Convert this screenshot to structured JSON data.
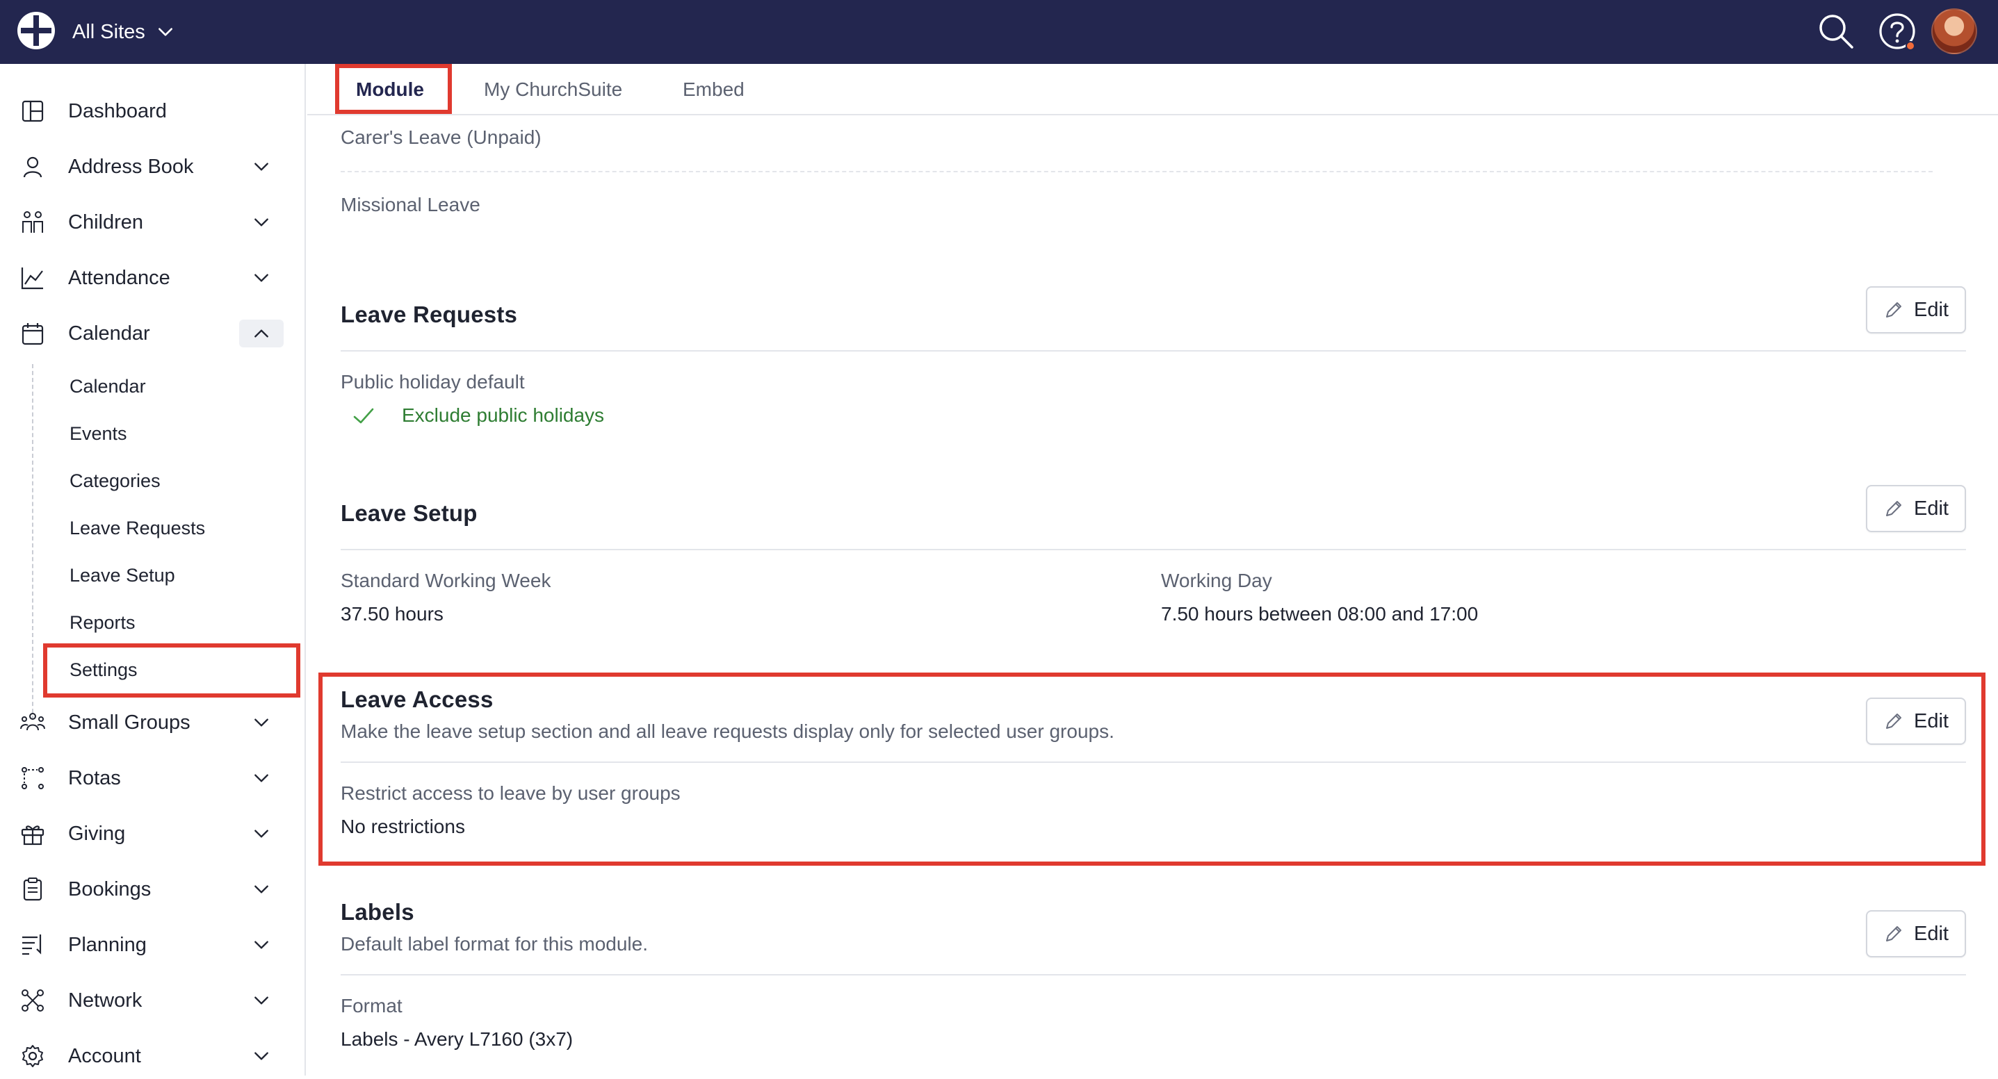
{
  "header": {
    "site_switch": "All Sites",
    "icons": [
      "churchsuite-logo-icon",
      "search-icon",
      "help-icon",
      "user-avatar"
    ],
    "colors": {
      "topbar": "#23264f",
      "highlight": "#e03a2f",
      "success": "#2e7d32"
    }
  },
  "sidebar": {
    "items": [
      {
        "label": "Dashboard",
        "icon": "dashboard-icon"
      },
      {
        "label": "Address Book",
        "icon": "person-icon"
      },
      {
        "label": "Children",
        "icon": "children-icon"
      },
      {
        "label": "Attendance",
        "icon": "chart-icon"
      },
      {
        "label": "Calendar",
        "icon": "calendar-icon"
      },
      {
        "label": "Small Groups",
        "icon": "groups-icon"
      },
      {
        "label": "Rotas",
        "icon": "rotas-icon"
      },
      {
        "label": "Giving",
        "icon": "gift-icon"
      },
      {
        "label": "Bookings",
        "icon": "clipboard-icon"
      },
      {
        "label": "Planning",
        "icon": "planning-icon"
      },
      {
        "label": "Network",
        "icon": "network-icon"
      },
      {
        "label": "Account",
        "icon": "gear-icon"
      }
    ],
    "calendar_sub": [
      "Calendar",
      "Events",
      "Categories",
      "Leave Requests",
      "Leave Setup",
      "Reports",
      "Settings"
    ]
  },
  "tabs": [
    "Module",
    "My ChurchSuite",
    "Embed"
  ],
  "leave_types": [
    "Carer's Leave (Unpaid)",
    "Missional Leave"
  ],
  "edit_label": "Edit",
  "leave_requests": {
    "title": "Leave Requests",
    "label": "Public holiday default",
    "value": "Exclude public holidays"
  },
  "leave_setup": {
    "title": "Leave Setup",
    "week_label": "Standard Working Week",
    "week_value": "37.50 hours",
    "day_label": "Working Day",
    "day_value": "7.50 hours between 08:00 and 17:00"
  },
  "leave_access": {
    "title": "Leave Access",
    "description": "Make the leave setup section and all leave requests display only for selected user groups.",
    "label": "Restrict access to leave by user groups",
    "value": "No restrictions"
  },
  "labels": {
    "title": "Labels",
    "description": "Default label format for this module.",
    "label": "Format",
    "value": "Labels - Avery L7160 (3x7)"
  }
}
